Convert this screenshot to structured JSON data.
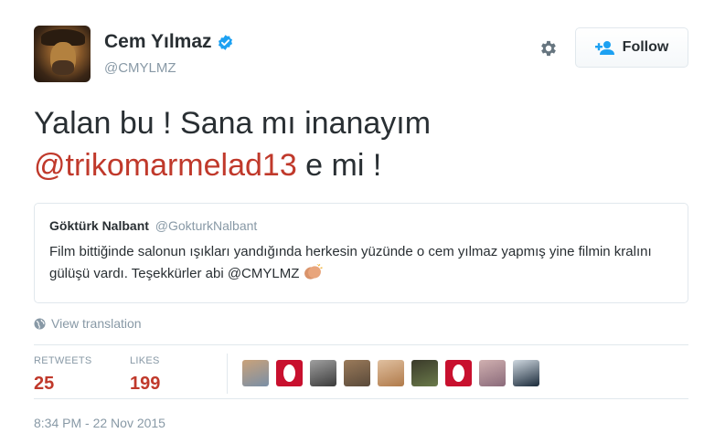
{
  "user": {
    "fullname": "Cem Yılmaz",
    "handle": "@CMYLMZ",
    "verified": true
  },
  "actions": {
    "follow_label": "Follow",
    "settings_icon": "gear-icon",
    "follow_icon": "add-user-icon"
  },
  "tweet": {
    "text_line1": "Yalan bu ! Sana mı inanayım",
    "mention": "@trikomarmelad13",
    "text_tail": " e mi !"
  },
  "quote": {
    "name": "Göktürk Nalbant",
    "handle": "@GokturkNalbant",
    "text": "Film bittiğinde salonun ışıkları yandığında herkesin yüzünde o cem yılmaz yapmış yine filmin kralını gülüşü vardı. Teşekkürler abi @CMYLMZ"
  },
  "translate_label": "View translation",
  "stats": {
    "retweets_label": "RETWEETS",
    "retweets": "25",
    "likes_label": "LIKES",
    "likes": "199"
  },
  "timestamp": "8:34 PM - 22 Nov 2015",
  "colors": {
    "accent": "#c0392b",
    "muted": "#8899a6",
    "verified": "#1da1f2",
    "border": "#e1e8ed"
  },
  "likers": [
    {
      "kind": "photo",
      "c1": "#7a8fa6",
      "c2": "#c9a27a"
    },
    {
      "kind": "logo",
      "c1": "#c8102e"
    },
    {
      "kind": "photo",
      "c1": "#3b3b3b",
      "c2": "#a0a0a0"
    },
    {
      "kind": "photo",
      "c1": "#5a4a3a",
      "c2": "#9a7a5a"
    },
    {
      "kind": "photo",
      "c1": "#b07a4a",
      "c2": "#e0c0a0"
    },
    {
      "kind": "photo",
      "c1": "#6a7a4a",
      "c2": "#3a3a2a"
    },
    {
      "kind": "logo",
      "c1": "#c8102e"
    },
    {
      "kind": "photo",
      "c1": "#8a6a7a",
      "c2": "#d0b0b0"
    },
    {
      "kind": "photo",
      "c1": "#1a2a3a",
      "c2": "#cfd8e0"
    }
  ]
}
